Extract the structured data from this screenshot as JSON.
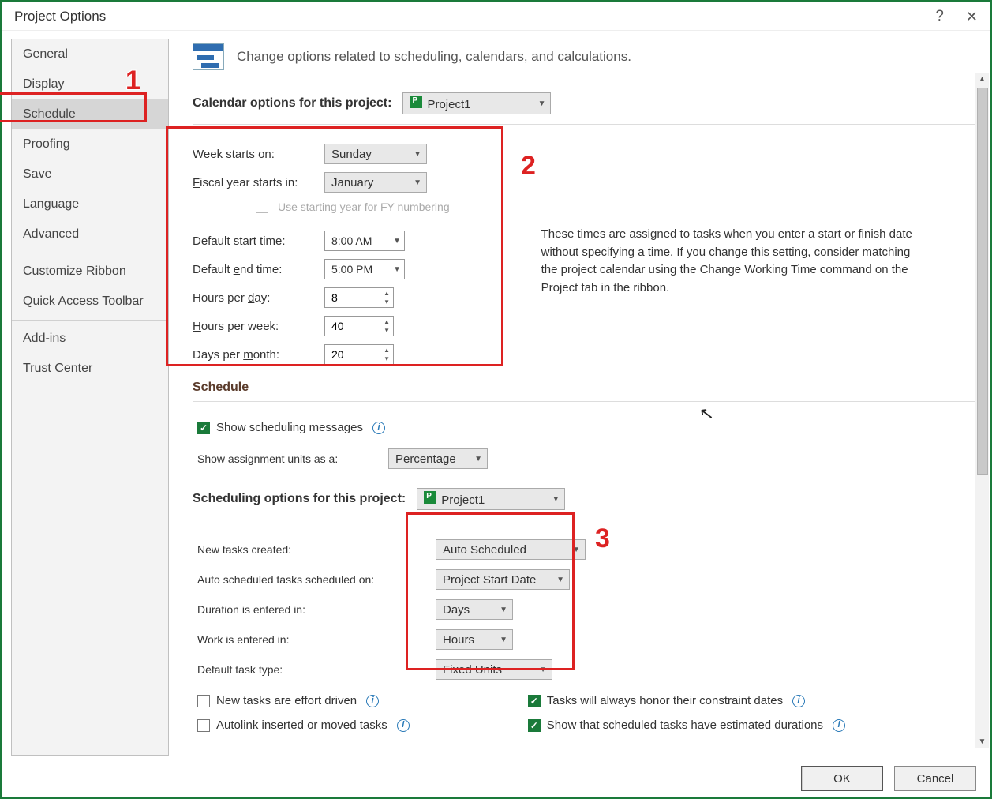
{
  "window": {
    "title": "Project Options"
  },
  "sidebar": {
    "items": [
      {
        "label": "General"
      },
      {
        "label": "Display"
      },
      {
        "label": "Schedule"
      },
      {
        "label": "Proofing"
      },
      {
        "label": "Save"
      },
      {
        "label": "Language"
      },
      {
        "label": "Advanced"
      },
      {
        "label": "Customize Ribbon"
      },
      {
        "label": "Quick Access Toolbar"
      },
      {
        "label": "Add-ins"
      },
      {
        "label": "Trust Center"
      }
    ]
  },
  "header": {
    "text": "Change options related to scheduling, calendars, and calculations."
  },
  "calendar": {
    "section_label": "Calendar options for this project:",
    "project": "Project1",
    "week_starts_label": "Week starts on:",
    "week_starts": "Sunday",
    "fiscal_label": "Fiscal year starts in:",
    "fiscal": "January",
    "fy_checkbox": "Use starting year for FY numbering",
    "default_start_label": "Default start time:",
    "default_start": "8:00 AM",
    "default_end_label": "Default end time:",
    "default_end": "5:00 PM",
    "hours_day_label": "Hours per day:",
    "hours_day": "8",
    "hours_week_label": "Hours per week:",
    "hours_week": "40",
    "days_month_label": "Days per month:",
    "days_month": "20",
    "note": "These times are assigned to tasks when you enter a start or finish date without specifying a time. If you change this setting, consider matching the project calendar using the Change Working Time command on the Project tab in the ribbon."
  },
  "schedule": {
    "title": "Schedule",
    "show_msgs": "Show scheduling messages",
    "assign_units_label": "Show assignment units as a:",
    "assign_units": "Percentage"
  },
  "sched_opts": {
    "section_label": "Scheduling options for this project:",
    "project": "Project1",
    "new_tasks_label": "New tasks created:",
    "new_tasks": "Auto Scheduled",
    "auto_sched_label": "Auto scheduled tasks scheduled on:",
    "auto_sched": "Project Start Date",
    "duration_label": "Duration is entered in:",
    "duration": "Days",
    "work_label": "Work is entered in:",
    "work": "Hours",
    "task_type_label": "Default task type:",
    "task_type": "Fixed Units",
    "cb_effort": "New tasks are effort driven",
    "cb_autolink": "Autolink inserted or moved tasks",
    "cb_honor": "Tasks will always honor their constraint dates",
    "cb_estimated": "Show that scheduled tasks have estimated durations"
  },
  "footer": {
    "ok": "OK",
    "cancel": "Cancel"
  },
  "annotations": {
    "n1": "1",
    "n2": "2",
    "n3": "3"
  }
}
